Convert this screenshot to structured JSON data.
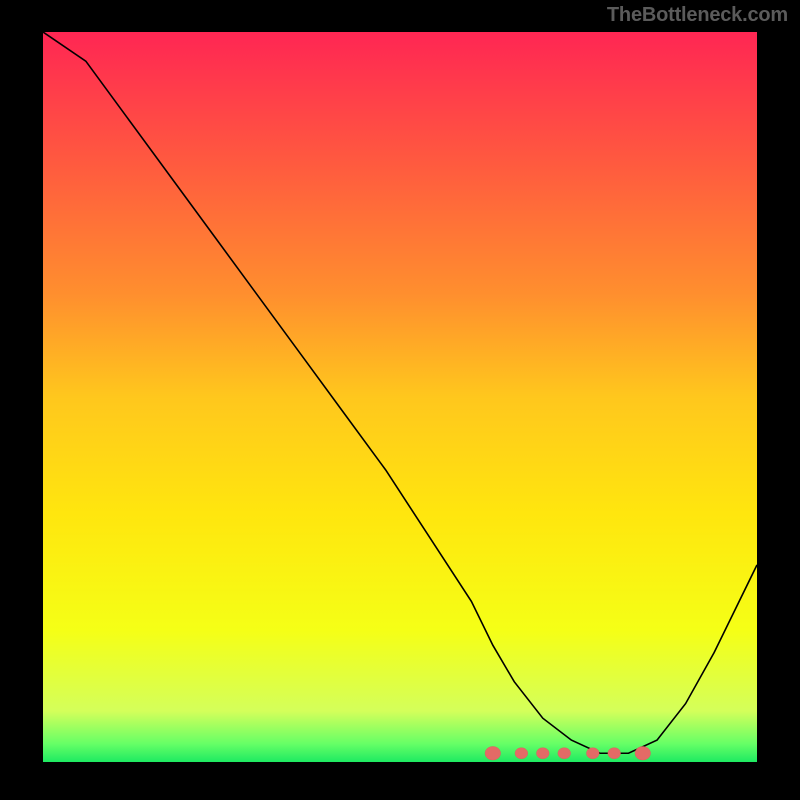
{
  "attribution": "TheBottleneck.com",
  "colors": {
    "marker_fill": "#e46a66",
    "marker_stroke": "#cf5854",
    "curve_stroke": "#000000"
  },
  "gradient_stops": [
    {
      "offset": 0,
      "color": "#ff2653"
    },
    {
      "offset": 0.18,
      "color": "#ff5a3f"
    },
    {
      "offset": 0.36,
      "color": "#ff8f2e"
    },
    {
      "offset": 0.5,
      "color": "#ffc71d"
    },
    {
      "offset": 0.66,
      "color": "#ffe60e"
    },
    {
      "offset": 0.82,
      "color": "#f5ff16"
    },
    {
      "offset": 0.93,
      "color": "#d4ff5a"
    },
    {
      "offset": 0.975,
      "color": "#66ff66"
    },
    {
      "offset": 1.0,
      "color": "#1eea62"
    }
  ],
  "chart_data": {
    "type": "line",
    "title": "",
    "xlabel": "",
    "ylabel": "",
    "xlim": [
      0,
      100
    ],
    "ylim": [
      0,
      100
    ],
    "series": [
      {
        "name": "bottleneck-curve",
        "x": [
          0,
          6,
          12,
          18,
          24,
          30,
          36,
          42,
          48,
          54,
          60,
          63,
          66,
          70,
          74,
          78,
          82,
          86,
          90,
          94,
          100
        ],
        "values": [
          100,
          96,
          88,
          80,
          72,
          64,
          56,
          48,
          40,
          31,
          22,
          16,
          11,
          6,
          3,
          1.2,
          1.2,
          3,
          8,
          15,
          27
        ]
      }
    ],
    "markers": {
      "y": 1.2,
      "x_positions": [
        63,
        67,
        70,
        73,
        77,
        80,
        84
      ]
    }
  }
}
